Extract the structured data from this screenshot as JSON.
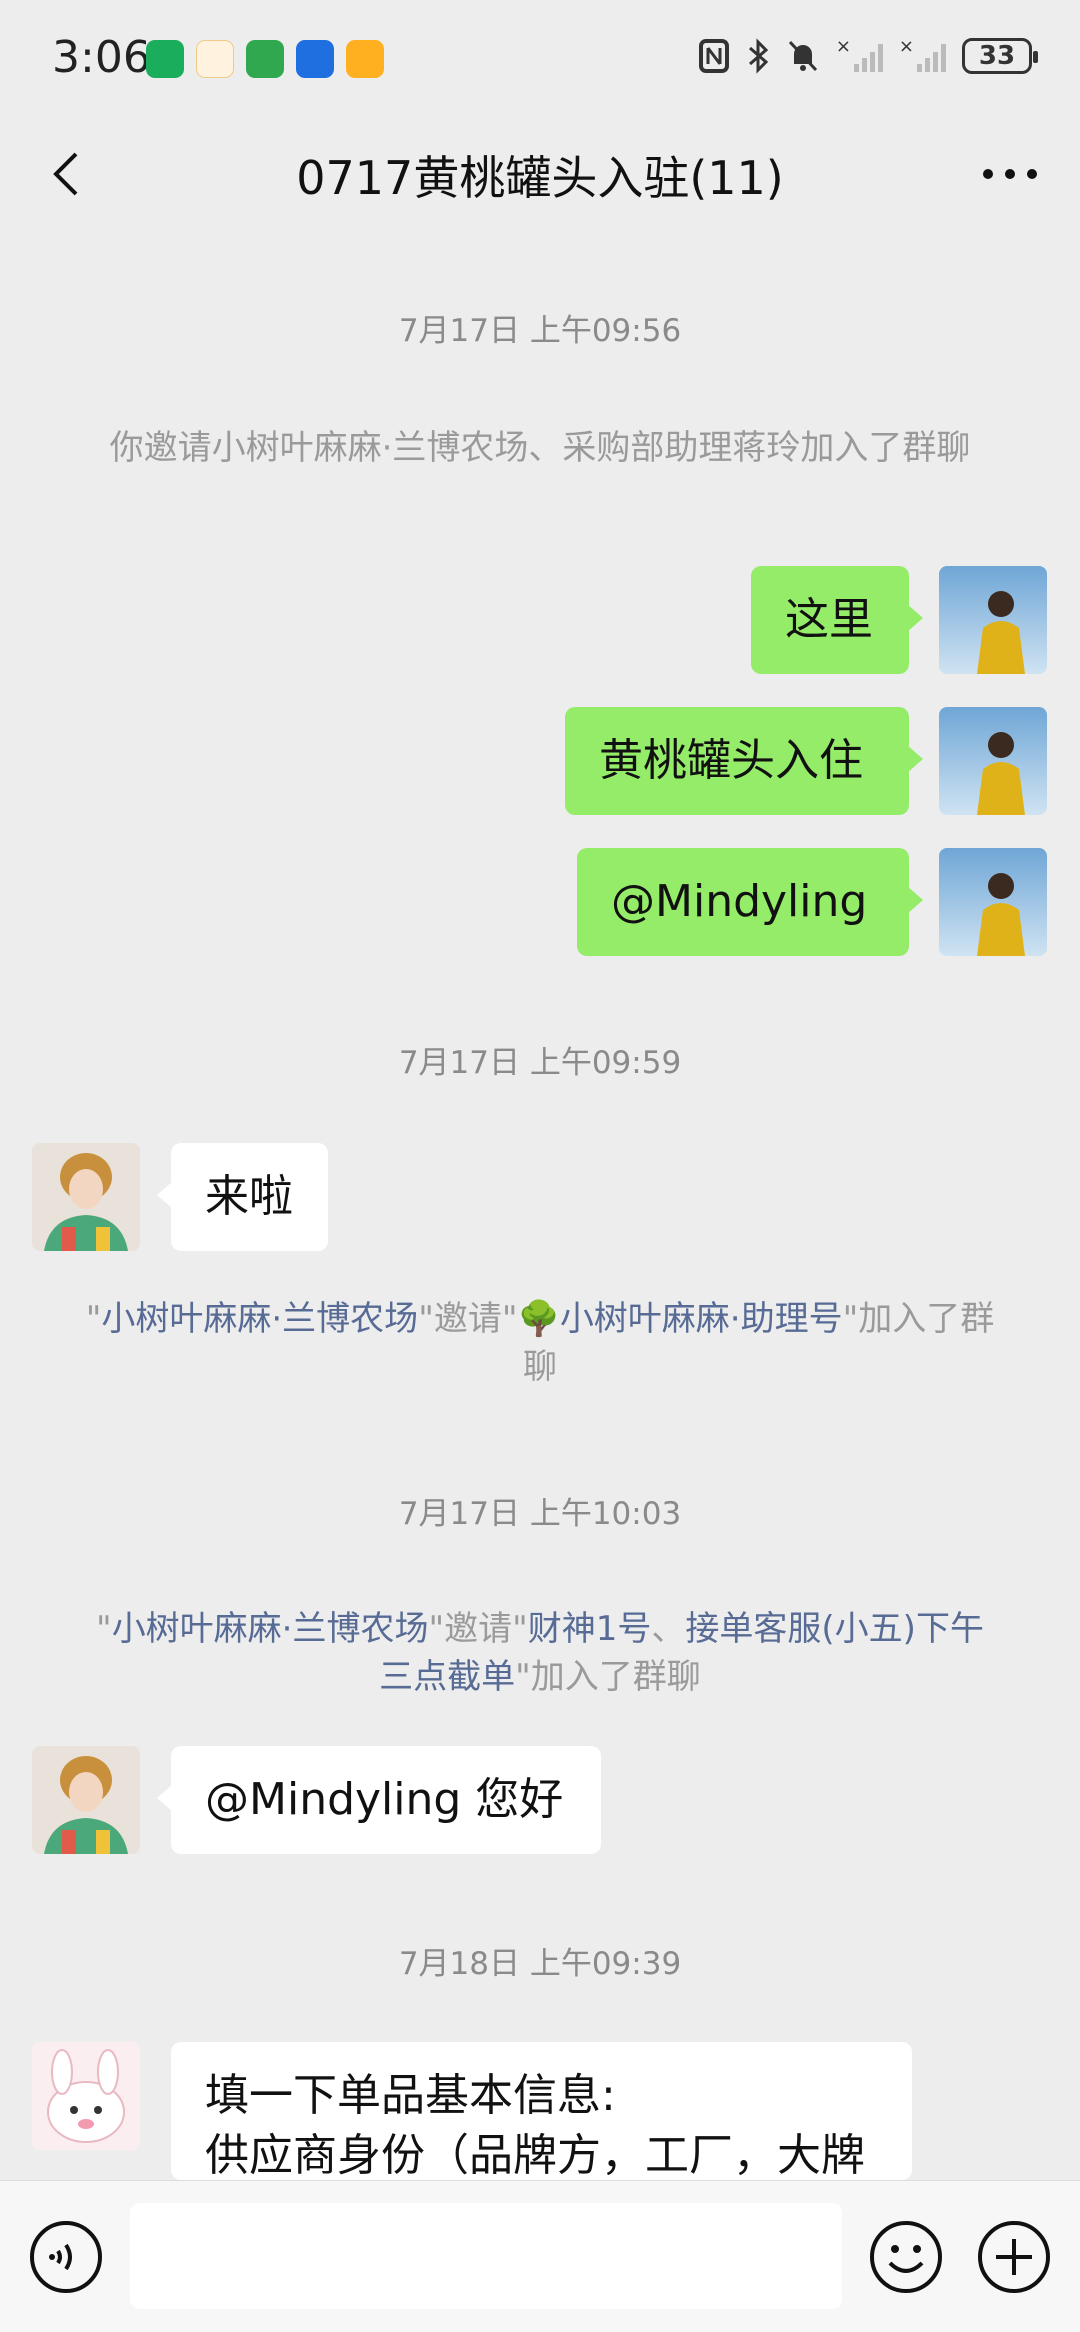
{
  "status_bar": {
    "time": "3:06",
    "battery": "33",
    "app_icons": [
      "tree-app-icon",
      "food-app-icon",
      "plant-app-icon",
      "plane-app-icon",
      "duck-app-icon"
    ],
    "right_icons": [
      "nfc-icon",
      "bluetooth-icon",
      "silent-bell-icon",
      "signal-x-icon",
      "signal-x-icon"
    ]
  },
  "header": {
    "title": "0717黄桃罐头入驻(11)"
  },
  "messages": {
    "ts1": "7月17日 上午09:56",
    "sys1": "你邀请小树叶麻麻·兰博农场、采购部助理蒋玲加入了群聊",
    "me1": "这里",
    "me2": "黄桃罐头入住",
    "me3": "@Mindyling",
    "ts2": "7月17日 上午09:59",
    "them1": "来啦",
    "sys2": {
      "q1": "\"",
      "inviter": "小树叶麻麻·兰博农场",
      "mid": "\"邀请\"",
      "emoji": "🌳",
      "invitee": "小树叶麻麻·助理号",
      "tail": "\"加入了群聊"
    },
    "ts3": "7月17日 上午10:03",
    "sys3": {
      "q1": "\"",
      "inviter": "小树叶麻麻·兰博农场",
      "mid": "\"邀请\"",
      "invitee1": "财神1号",
      "sep": "、",
      "invitee2": "接单客服(小五)下午三点截单",
      "tail": "\"加入了群聊"
    },
    "them2": "@Mindyling 您好",
    "ts4": "7月18日 上午09:39",
    "them3_line1": "填一下单品基本信息:",
    "them3_line2": "供应商身份（品牌方，工厂，大牌"
  },
  "input_bar": {
    "placeholder": ""
  },
  "colors": {
    "background": "#ededed",
    "my_bubble": "#95ec69",
    "their_bubble": "#ffffff",
    "link": "#576b95",
    "system_text": "#9a9a9a"
  }
}
